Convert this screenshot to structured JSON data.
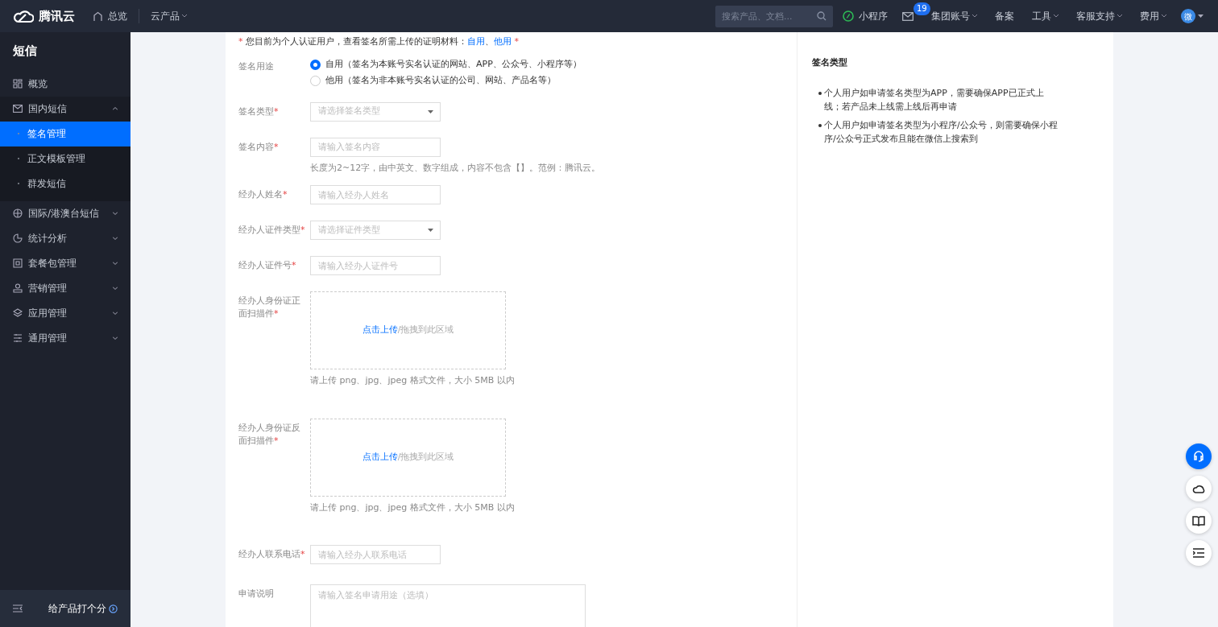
{
  "topbar": {
    "logo_text": "腾讯云",
    "overview": "总览",
    "products": "云产品",
    "search": {
      "placeholder": "搜索产品、文档..."
    },
    "mini_program": "小程序",
    "mail_badge": "19",
    "menus": [
      {
        "label": "集团账号",
        "dropdown": true
      },
      {
        "label": "备案",
        "dropdown": false
      },
      {
        "label": "工具",
        "dropdown": true
      },
      {
        "label": "客服支持",
        "dropdown": true
      },
      {
        "label": "费用",
        "dropdown": true
      }
    ],
    "avatar": "微"
  },
  "sidebar": {
    "title": "短信",
    "items": [
      {
        "label": "概览",
        "kind": "link"
      },
      {
        "label": "国内短信",
        "kind": "group",
        "expanded": true,
        "children": [
          {
            "label": "签名管理",
            "selected": true
          },
          {
            "label": "正文模板管理",
            "selected": false
          },
          {
            "label": "群发短信",
            "selected": false
          }
        ]
      },
      {
        "label": "国际/港澳台短信",
        "kind": "group",
        "expanded": false
      },
      {
        "label": "统计分析",
        "kind": "group",
        "expanded": false
      },
      {
        "label": "套餐包管理",
        "kind": "group",
        "expanded": false
      },
      {
        "label": "营销管理",
        "kind": "group",
        "expanded": false
      },
      {
        "label": "应用管理",
        "kind": "group",
        "expanded": false
      },
      {
        "label": "通用管理",
        "kind": "group",
        "expanded": false
      }
    ],
    "footer": "给产品打个分"
  },
  "form": {
    "required_mark": "*",
    "notice": {
      "text": "您目前为个人认证用户，查看签名所需上传的证明材料：",
      "links": [
        "自用",
        "他用"
      ],
      "separator": "、"
    },
    "fields": [
      {
        "kind": "radio",
        "label": "签名用途",
        "required": false,
        "options": [
          {
            "label": "自用（签名为本账号实名认证的网站、APP、公众号、小程序等）",
            "selected": true
          },
          {
            "label": "他用（签名为非本账号实名认证的公司、网站、产品名等）",
            "selected": false
          }
        ]
      },
      {
        "kind": "select",
        "label": "签名类型",
        "required": true,
        "placeholder": "请选择签名类型"
      },
      {
        "kind": "text",
        "label": "签名内容",
        "required": true,
        "placeholder": "请输入签名内容",
        "hint": "长度为2~12字，由中英文、数字组成，内容不包含【】。范例：腾讯云。"
      },
      {
        "kind": "text",
        "label": "经办人姓名",
        "required": true,
        "placeholder": "请输入经办人姓名"
      },
      {
        "kind": "select",
        "label": "经办人证件类型",
        "required": true,
        "placeholder": "请选择证件类型"
      },
      {
        "kind": "text",
        "label": "经办人证件号",
        "required": true,
        "placeholder": "请输入经办人证件号"
      },
      {
        "kind": "upload",
        "label": "经办人身份证正面扫描件",
        "required": true,
        "link": "点击上传",
        "text": "/拖拽到此区域",
        "hint": "请上传 png、jpg、jpeg 格式文件，大小 5MB 以内"
      },
      {
        "kind": "upload",
        "label": "经办人身份证反面扫描件",
        "required": true,
        "link": "点击上传",
        "text": "/拖拽到此区域",
        "hint": "请上传 png、jpg、jpeg 格式文件，大小 5MB 以内"
      },
      {
        "kind": "text",
        "label": "经办人联系电话",
        "required": true,
        "placeholder": "请输入经办人联系电话"
      },
      {
        "kind": "textarea",
        "label": "申请说明",
        "required": false,
        "placeholder": "请输入签名申请用途（选填）"
      }
    ]
  },
  "help": {
    "title": "签名类型",
    "items": [
      "个人用户如申请签名类型为APP，需要确保APP已正式上线；若产品未上线需上线后再申请",
      "个人用户如申请签名类型为小程序/公众号，则需要确保小程序/公众号正式发布且能在微信上搜索到"
    ]
  }
}
